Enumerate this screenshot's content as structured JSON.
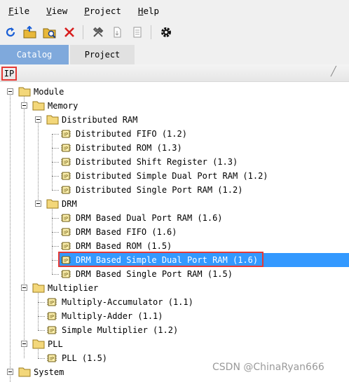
{
  "menu": [
    {
      "key": "F",
      "rest": "ile"
    },
    {
      "key": "V",
      "rest": "iew"
    },
    {
      "key": "P",
      "rest": "roject"
    },
    {
      "key": "H",
      "rest": "elp"
    }
  ],
  "toolbar": {
    "buttons": [
      "refresh-icon",
      "open-folder-icon",
      "search-folder-icon",
      "delete-icon",
      "build-icon",
      "export-icon",
      "document-icon",
      "settings-icon"
    ]
  },
  "tabs": [
    {
      "label": "Catalog",
      "active": true
    },
    {
      "label": "Project",
      "active": false
    }
  ],
  "ip_label": "IP",
  "tree": [
    {
      "label": "Module",
      "type": "folder"
    },
    {
      "label": "Memory",
      "type": "folder"
    },
    {
      "label": "Distributed RAM",
      "type": "folder"
    },
    {
      "label": "Distributed FIFO (1.2)",
      "type": "ip"
    },
    {
      "label": "Distributed ROM (1.3)",
      "type": "ip"
    },
    {
      "label": "Distributed Shift Register (1.3)",
      "type": "ip"
    },
    {
      "label": "Distributed Simple Dual Port RAM (1.2)",
      "type": "ip"
    },
    {
      "label": "Distributed Single Port RAM (1.2)",
      "type": "ip"
    },
    {
      "label": "DRM",
      "type": "folder"
    },
    {
      "label": "DRM Based Dual Port RAM (1.6)",
      "type": "ip"
    },
    {
      "label": "DRM Based FIFO (1.6)",
      "type": "ip"
    },
    {
      "label": "DRM Based ROM (1.5)",
      "type": "ip"
    },
    {
      "label": "DRM Based Simple Dual Port RAM (1.6)",
      "type": "ip",
      "selected": true
    },
    {
      "label": "DRM Based Single Port RAM (1.5)",
      "type": "ip"
    },
    {
      "label": "Multiplier",
      "type": "folder"
    },
    {
      "label": "Multiply-Accumulator (1.1)",
      "type": "ip"
    },
    {
      "label": "Multiply-Adder (1.1)",
      "type": "ip"
    },
    {
      "label": "Simple Multiplier (1.2)",
      "type": "ip"
    },
    {
      "label": "PLL",
      "type": "folder"
    },
    {
      "label": "PLL (1.5)",
      "type": "ip"
    },
    {
      "label": "System",
      "type": "folder"
    }
  ],
  "colors": {
    "accent": "#3399ff",
    "tab_active": "#7fa9dc",
    "highlight": "#e53935",
    "folder": "#f3d77a"
  },
  "watermark": "CSDN @ChinaRyan666"
}
